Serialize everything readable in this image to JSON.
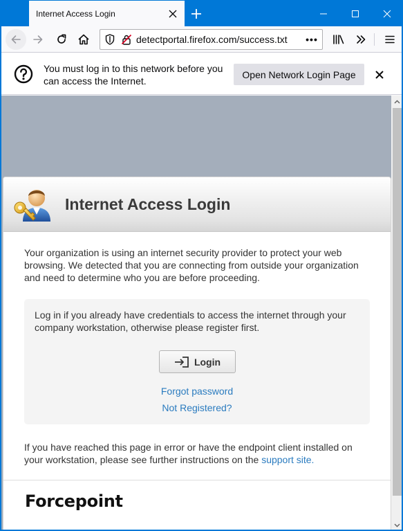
{
  "tab": {
    "title": "Internet Access Login"
  },
  "toolbar": {
    "url": "detectportal.firefox.com/success.txt",
    "more": "•••"
  },
  "notification": {
    "message": "You must log in to this network before you can access the Internet.",
    "button_label": "Open Network Login Page"
  },
  "page": {
    "title": "Internet Access Login",
    "intro": "Your organization is using an internet security provider to protect your web browsing. We detected that you are connecting from outside your organization and need to determine who you are before proceeding.",
    "login_prompt": "Log in if you already have credentials to access the internet through your company workstation, otherwise please register first.",
    "login_button": "Login",
    "forgot_password": "Forgot password",
    "not_registered": "Not Registered?",
    "footer_text": "If you have reached this page in error or have the endpoint client installed on your workstation, please see further instructions on the",
    "support_link": "support site.",
    "brand": "Forcepoint"
  },
  "colors": {
    "titlebar": "#0078d7",
    "page_background": "#a4aebb",
    "link": "#2a7bbf"
  }
}
